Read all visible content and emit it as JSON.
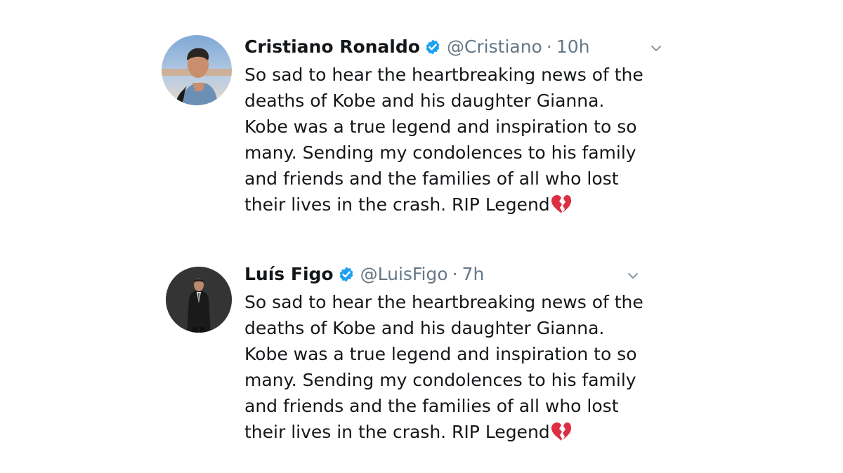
{
  "colors": {
    "verified_badge": "#1da1f2",
    "secondary_text": "#657786",
    "primary_text": "#14171a",
    "broken_heart": "#dd2e44"
  },
  "tweets": [
    {
      "avatar": "cristiano-ronaldo-profile-photo",
      "name": "Cristiano Ronaldo",
      "verified_icon": "verified-badge-icon",
      "handle": "@Cristiano",
      "separator": "·",
      "time": "10h",
      "menu_icon": "chevron-down-icon",
      "text_lines": [
        "So sad to hear the heartbreaking news of the",
        "deaths of Kobe and his daughter Gianna.",
        "Kobe was a true legend and inspiration to so",
        "many. Sending my condolences to his family",
        "and friends and the families of all who lost",
        "their lives in the crash. RIP Legend"
      ],
      "emoji": "broken-heart-icon"
    },
    {
      "avatar": "luis-figo-profile-photo",
      "name": "Luís Figo",
      "verified_icon": "verified-badge-icon",
      "handle": "@LuisFigo",
      "separator": "·",
      "time": "7h",
      "menu_icon": "chevron-down-icon",
      "text_lines": [
        "So sad to hear the heartbreaking news of the",
        "deaths of Kobe and his daughter Gianna.",
        "Kobe was a true legend and inspiration to so",
        "many. Sending my condolences to his family",
        "and friends and the families of all who lost",
        "their lives in the crash. RIP Legend"
      ],
      "emoji": "broken-heart-icon"
    }
  ]
}
